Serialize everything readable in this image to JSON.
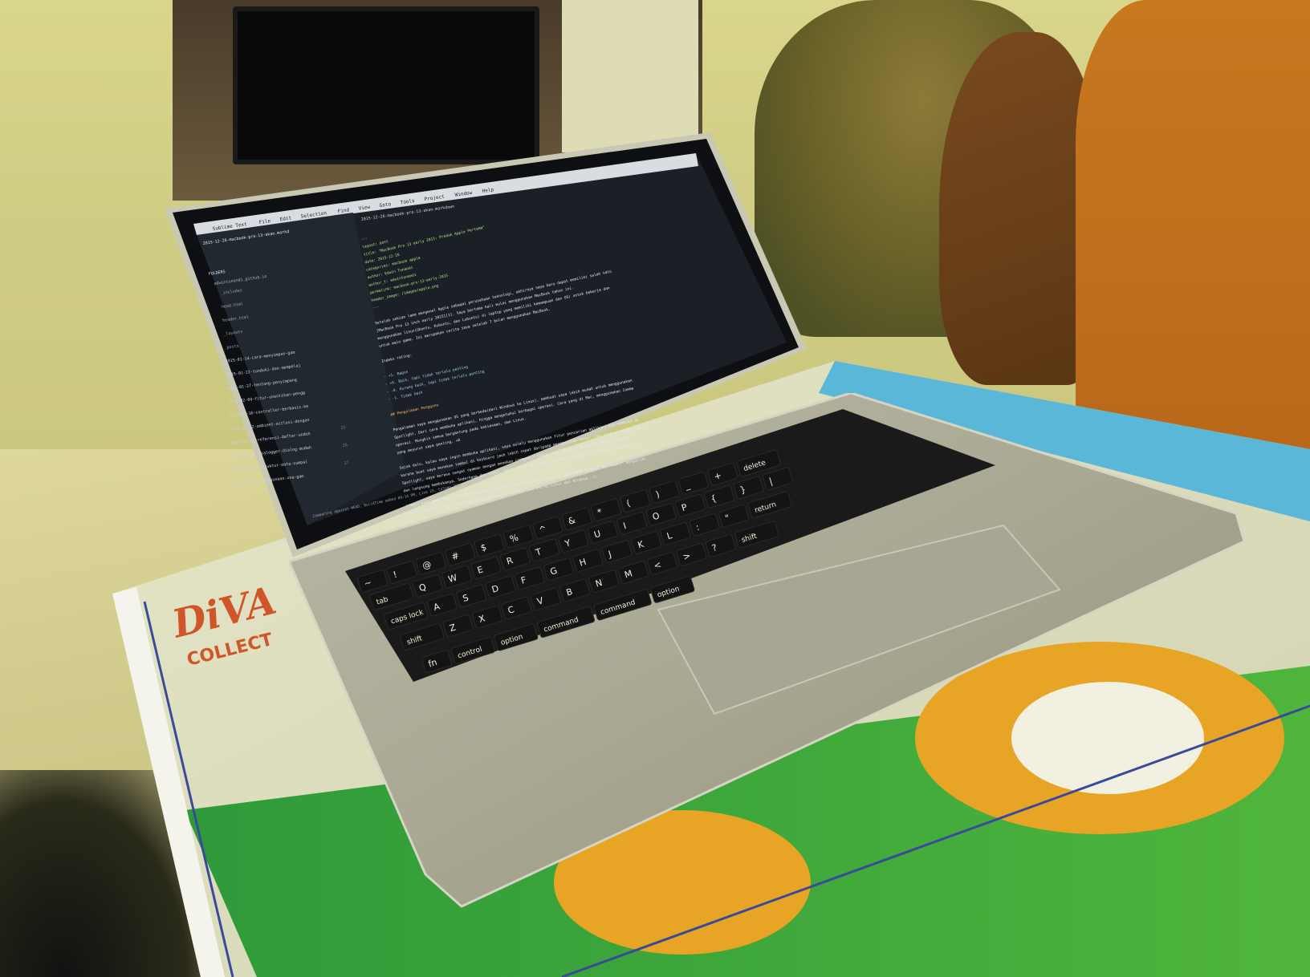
{
  "photo": {
    "box_brand": "DiVA",
    "box_brand_sub": "COLLECT"
  },
  "screen": {
    "menu_bar": [
      "Sublime Text",
      "File",
      "Edit",
      "Selection",
      "Find",
      "View",
      "Goto",
      "Tools",
      "Project",
      "Window",
      "Help"
    ],
    "tab_title": "2015-12-26-macbook-pro-13-akan.markdown",
    "sidebar_open_file": "2015-12-26-macbook-pro-13-akan.markd",
    "sidebar_folders_label": "FOLDERS",
    "sidebar_folder_root": "edwintunandi.github.io",
    "sidebar_items": [
      "_includes",
      "head.html",
      "header.html",
      "_layouts",
      "_posts",
      "2015-01-14-cara-menyimpan-gam",
      "2015-01-22-tunduki-dan-mempelaj",
      "2015-01-27-tentang-penyimpang",
      "2015-02-04-fitur-unentikan-pengg",
      "2015-02-16-controller-berbasis-ke",
      "2015-03-12-ambient-occlusi-dengan",
      "2015-03-29-referensi-daftar-unduh",
      "2015-04-21-dialogger-dialog-mudah",
      "2015-06-02-struktur-data-sumpal",
      "2015-06-19-penggunaan-xna-gam"
    ],
    "code_lines": [
      "---",
      "layout: post",
      "title: \"MacBook Pro 13 early 2015: Produk Apple Pertama\"",
      "date: 2015-12-26",
      "categories: macbook apple",
      "author: Edwin Tunandi",
      "author_t: edwintunandi",
      "permalink: macbook-pro-13-early-2015",
      "header_image: /images/apple.png",
      "---",
      "",
      "Setelah sekian lama mengenal Apple sebagai perusahaan teknologi, akhirnya saya baru dapat memiliki salah satu produknya,",
      "[MacBook Pro 13 inch early 2015][1]. Saya bertama kali mulai menggunakan MacBook tahun ini.",
      "menggunakan linux(Ubuntu, Kubuntu, dan Lubuntu) di laptop yang memiliki kemampuan dan OS) untuk bekerja dan",
      "untuk main game. Ini merupakan cerita saya setelah 7 bulan menggunakan MacBook.",
      "",
      "Indeks rating:",
      "",
      "- +1. Bagus",
      "- +0. Baik, tapi tidak terlalu penting",
      "- -0. Kurang baik, tapi tidak terlalu penting",
      "- -1. Tidak baik",
      "",
      "## Pengalaman Pengguna",
      "",
      "Pengalaman saya menggunakan OS yang berbeda(dari Windows ke Linux), membuat saya lebih mudah untuk menggunakan Mac OS, pasti",
      "Spotlight. Dari cara membuka aplikasi, hingga mengetahui berbagai operasi. Cara yang di Mac, menggunakan Command",
      "operasi. Mungkin semua bergantung pada kebiasaan, dan Linux.",
      "yang meyurut saya penting. +0",
      "",
      "Sejak dulu, kalau saya ingin membuka aplikasi, saya selalu menggunakan fitur pencarian aplikasi dan membuka aplikasi",
      "karena buat saya menekan tombol di keyboard jauh lebih cepat daripada menggunakan mouse. Dan saya kira Mac juga punya",
      "Spotlight, saya merasa sangat nyaman dengan menekan command + space lalu langsung mengetik nama aplikasi",
      "dan langsung membukanya. Sederhana dan cepat. Lebih cepat daripada yang saya rasakan di Linux dan Windows. +1",
      "",
      "**Wah, yang buat saya senang menggunakan Macbook adalah karena transisi dari mode *sleep* ke *awake* sangatlah cepat dan",
      "tanpa masalah**. Saya mengalami banyak masalah terkait hal ini di Linux dan Windows. +1"
    ],
    "line_numbers": [
      "25",
      "26",
      "27"
    ],
    "status_bar": "Comparing against HEAD, BuildTime added 09:14 PM, Line 25, Column 208"
  },
  "keyboard": {
    "row1": [
      "~",
      "!",
      "@",
      "#",
      "$",
      "%",
      "^",
      "&",
      "*",
      "(",
      ")",
      "_",
      "+",
      "delete"
    ],
    "row_q": [
      "tab",
      "Q",
      "W",
      "E",
      "R",
      "T",
      "Y",
      "U",
      "I",
      "O",
      "P",
      "{",
      "}",
      "|"
    ],
    "row_a": [
      "caps lock",
      "A",
      "S",
      "D",
      "F",
      "G",
      "H",
      "J",
      "K",
      "L",
      ":",
      "\"",
      "return"
    ],
    "row_z": [
      "shift",
      "Z",
      "X",
      "C",
      "V",
      "B",
      "N",
      "M",
      "<",
      ">",
      "?",
      "shift"
    ],
    "row_bottom": [
      "fn",
      "control",
      "option",
      "command",
      "command",
      "option"
    ]
  }
}
